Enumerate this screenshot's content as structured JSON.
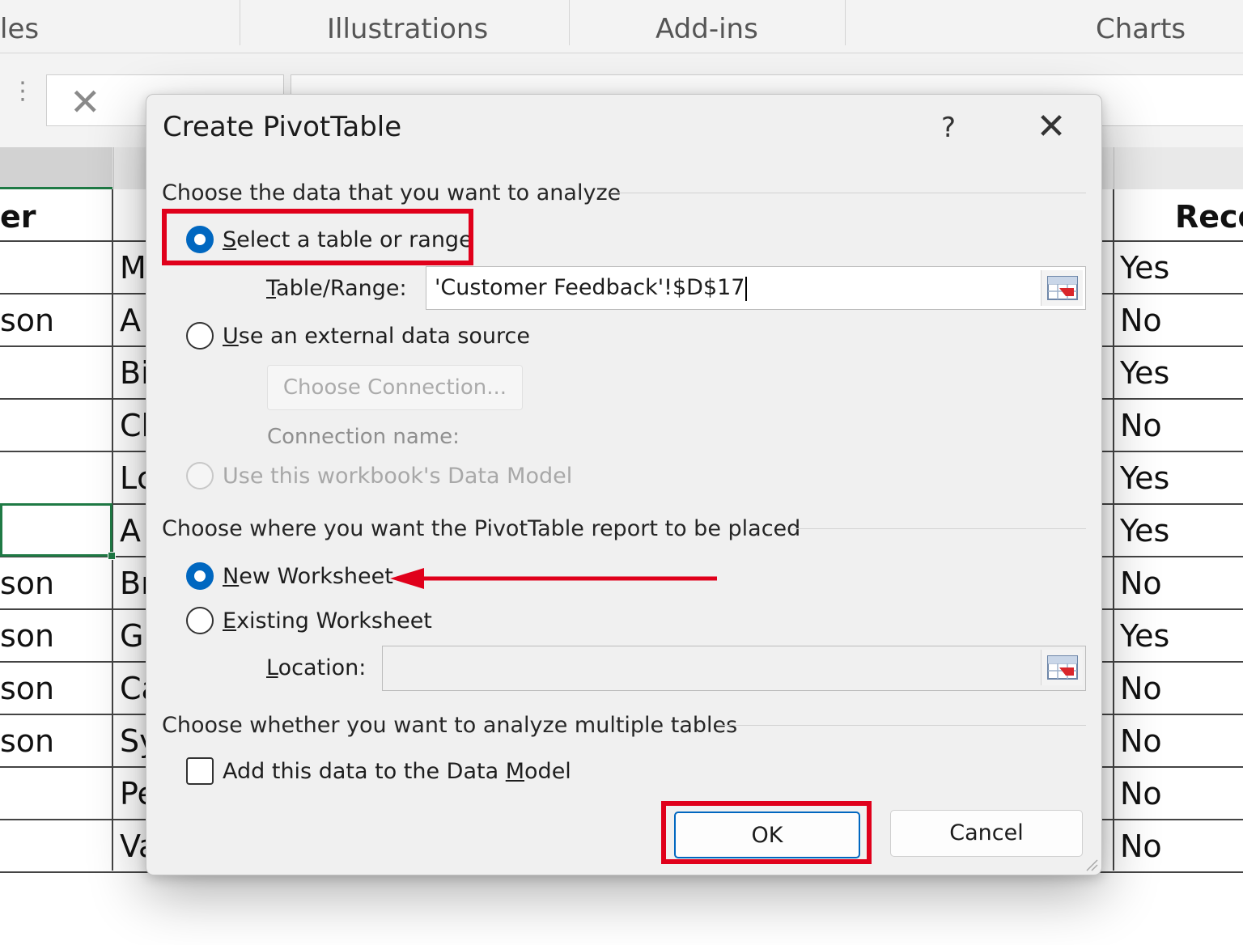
{
  "ribbon": {
    "groups": [
      "les",
      "Illustrations",
      "Add-ins",
      "Charts"
    ]
  },
  "sheet": {
    "col_a_header": "er",
    "col_c_header": "Reco",
    "col_a": [
      "",
      "son",
      "",
      "",
      "",
      "",
      "son",
      "son",
      "son",
      "son",
      "",
      ""
    ],
    "col_b": [
      "M",
      "A",
      "Bi",
      "Cl",
      "Lc",
      "A",
      "Br",
      "G",
      "Ca",
      "Sy",
      "Pe",
      "Va"
    ],
    "col_c": [
      "Yes",
      "No",
      "Yes",
      "No",
      "Yes",
      "Yes",
      "No",
      "Yes",
      "No",
      "No",
      "No",
      "No"
    ]
  },
  "dialog": {
    "title": "Create PivotTable",
    "help": "?",
    "close": "✕",
    "section1": "Choose the data that you want to analyze",
    "opt_select_range": "elect a table or range",
    "opt_select_range_u": "S",
    "table_range_label_u": "T",
    "table_range_label": "able/Range:",
    "table_range_value": "'Customer Feedback'!$D$17",
    "opt_external_u": "U",
    "opt_external": "se an external data source",
    "choose_connection": "Choose Connection...",
    "connection_name_label": "Connection name:",
    "opt_data_model": "Use this workbook's Data Model",
    "section2": "Choose where you want the PivotTable report to be placed",
    "opt_new_ws_u": "N",
    "opt_new_ws": "ew Worksheet",
    "opt_existing_ws_u": "E",
    "opt_existing_ws": "xisting Worksheet",
    "location_label_u": "L",
    "location_label": "ocation:",
    "location_value": "",
    "section3": "Choose whether you want to analyze multiple tables",
    "add_model_pre": "Add this data to the Data ",
    "add_model_u": "M",
    "add_model_post": "odel",
    "ok": "OK",
    "cancel": "Cancel"
  },
  "colors": {
    "accent": "#0067c0",
    "highlight": "#e0001b",
    "selection": "#1f7a45"
  }
}
